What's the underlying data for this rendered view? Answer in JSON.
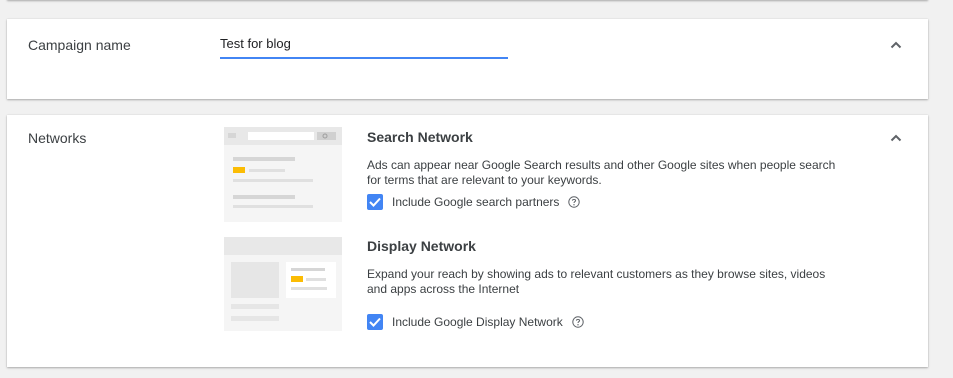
{
  "campaign_name": {
    "label": "Campaign name",
    "value": "Test for blog"
  },
  "networks": {
    "label": "Networks",
    "search": {
      "title": "Search Network",
      "description": "Ads can appear near Google Search results and other Google sites when people search for terms that are relevant to your keywords.",
      "checkbox_label": "Include Google search partners",
      "checked": true
    },
    "display": {
      "title": "Display Network",
      "description": "Expand your reach by showing ads to relevant customers as they browse sites, videos and apps across the Internet",
      "checkbox_label": "Include Google Display Network",
      "checked": true
    }
  },
  "colors": {
    "accent": "#4285f4",
    "ad_highlight": "#fbbc04"
  },
  "icons": [
    "chevron-up-icon",
    "checkmark-icon",
    "help-circle-icon",
    "search-network-illustration",
    "display-network-illustration"
  ]
}
